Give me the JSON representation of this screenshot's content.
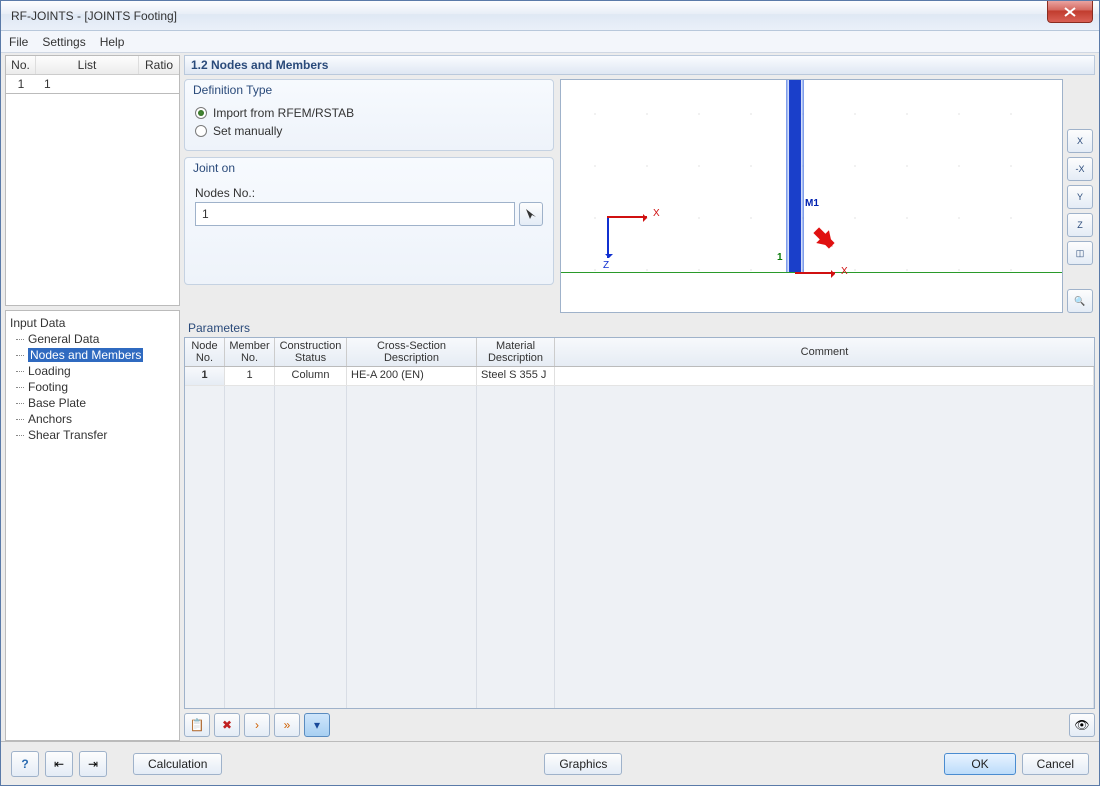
{
  "window": {
    "title": "RF-JOINTS - [JOINTS Footing]"
  },
  "menu": {
    "file": "File",
    "settings": "Settings",
    "help": "Help"
  },
  "top_table": {
    "headers": {
      "no": "No.",
      "list": "List",
      "ratio": "Ratio"
    },
    "rows": [
      {
        "no": "1",
        "list": "1",
        "ratio": ""
      }
    ]
  },
  "tree": {
    "root": "Input Data",
    "items": [
      {
        "label": "General Data"
      },
      {
        "label": "Nodes and Members",
        "selected": true
      },
      {
        "label": "Loading"
      },
      {
        "label": "Footing"
      },
      {
        "label": "Base Plate"
      },
      {
        "label": "Anchors"
      },
      {
        "label": "Shear Transfer"
      }
    ]
  },
  "section_title": "1.2 Nodes and Members",
  "definition": {
    "title": "Definition Type",
    "import": "Import from RFEM/RSTAB",
    "manual": "Set manually"
  },
  "joint_on": {
    "title": "Joint on",
    "label": "Nodes No.:",
    "value": "1"
  },
  "viewport": {
    "member_label": "M1",
    "node_label": "1",
    "axis_x": "X",
    "axis_z": "Z"
  },
  "parameters": {
    "title": "Parameters",
    "headers": {
      "node": "Node\nNo.",
      "member": "Member\nNo.",
      "construction": "Construction\nStatus",
      "cross": "Cross-Section\nDescription",
      "material": "Material\nDescription",
      "comment": "Comment"
    },
    "rows": [
      {
        "node": "1",
        "member": "1",
        "construction": "Column",
        "cross": "HE-A 200 (EN)",
        "material": "Steel S 355 J",
        "comment": ""
      }
    ]
  },
  "footer": {
    "calculation": "Calculation",
    "graphics": "Graphics",
    "ok": "OK",
    "cancel": "Cancel"
  }
}
